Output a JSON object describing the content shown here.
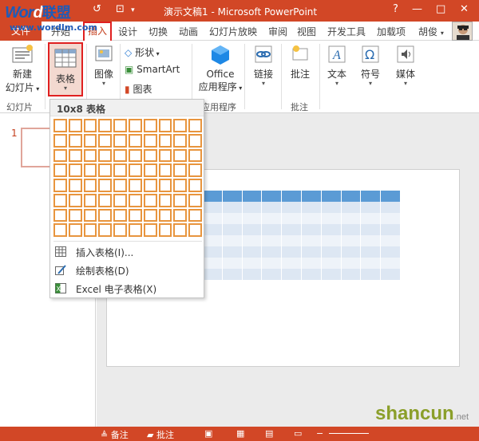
{
  "branding": {
    "logo_word_a": "Wor",
    "logo_word_b": "d",
    "logo_cn": "联盟",
    "logo_url": "www.wordlm.com",
    "watermark_main": "shancun",
    "watermark_sub": ".net"
  },
  "title": "演示文稿1 - Microsoft PowerPoint",
  "window_controls": [
    "?",
    "—",
    "□",
    "✕"
  ],
  "tabs": {
    "file": "文件",
    "home": "开始",
    "insert": "插入",
    "others": [
      "设计",
      "切换",
      "动画",
      "幻灯片放映",
      "审阅",
      "视图",
      "开发工具",
      "加载项"
    ],
    "user": "胡俊"
  },
  "ribbon": {
    "new_slide_line1": "新建",
    "new_slide_line2": "幻灯片",
    "table": "表格",
    "image": "图像",
    "shapes": "形状",
    "smartart": "SmartArt",
    "chart": "图表",
    "office_line1": "Office",
    "office_line2": "应用程序",
    "link": "链接",
    "comment": "批注",
    "text": "文本",
    "symbol": "符号",
    "media": "媒体",
    "groups": {
      "slides": "幻灯片",
      "apps": "应用程序",
      "comments": "批注"
    }
  },
  "slide_pane": {
    "number": "1"
  },
  "table_dropdown": {
    "header": "10x8 表格",
    "cols": 10,
    "rows": 8,
    "items": [
      {
        "label": "插入表格(I)...",
        "icon": "table-insert-icon"
      },
      {
        "label": "绘制表格(D)",
        "icon": "draw-table-icon"
      },
      {
        "label": "Excel 电子表格(X)",
        "icon": "excel-icon"
      }
    ]
  },
  "slide_table": {
    "cols": 10,
    "rows": 8,
    "header_color": "#5b9bd5",
    "band_color": "#dde7f3",
    "alt_color": "#eef3f9"
  },
  "statusbar": {
    "notes": "备注",
    "comments": "批注"
  },
  "colors": {
    "accent": "#d24726",
    "grid_border": "#e8953e",
    "highlight": "#e02020"
  }
}
